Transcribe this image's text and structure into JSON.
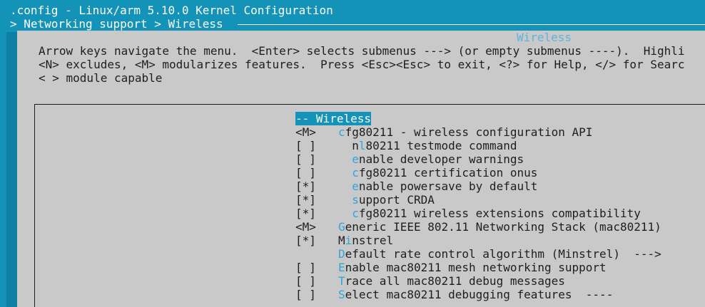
{
  "window": {
    "title": ".config - Linux/arm 5.10.0 Kernel Configuration",
    "breadcrumb": "> Networking support > Wireless"
  },
  "dialog": {
    "title": "Wireless",
    "help": [
      "Arrow keys navigate the menu.  <Enter> selects submenus ---> (or empty submenus ----).  Highli",
      "<N> excludes, <M> modularizes features.  Press <Esc><Esc> to exit, <?> for Help, </> for Searc",
      "< > module capable"
    ]
  },
  "menu": [
    {
      "state": "-",
      "pre": "-",
      "hot": "",
      "rest": " Wireless",
      "selected": true
    },
    {
      "state": "<M>",
      "pre": "",
      "hot": "c",
      "rest": "fg80211 - wireless configuration API"
    },
    {
      "state": "[ ]",
      "pre": "  n",
      "hot": "l",
      "rest": "80211 testmode command"
    },
    {
      "state": "[ ]",
      "pre": "  ",
      "hot": "e",
      "rest": "nable developer warnings"
    },
    {
      "state": "[ ]",
      "pre": "  ",
      "hot": "c",
      "rest": "fg80211 certification onus"
    },
    {
      "state": "[*]",
      "pre": "  ",
      "hot": "e",
      "rest": "nable powersave by default"
    },
    {
      "state": "[*]",
      "pre": "  ",
      "hot": "s",
      "rest": "upport CRDA"
    },
    {
      "state": "[*]",
      "pre": "  ",
      "hot": "c",
      "rest": "fg80211 wireless extensions compatibility"
    },
    {
      "state": "<M>",
      "pre": "",
      "hot": "G",
      "rest": "eneric IEEE 802.11 Networking Stack (mac80211)"
    },
    {
      "state": "[*]",
      "pre": "M",
      "hot": "i",
      "rest": "nstrel"
    },
    {
      "state": "",
      "pre": "",
      "hot": "D",
      "rest": "efault rate control algorithm (Minstrel)  --->"
    },
    {
      "state": "[ ]",
      "pre": "",
      "hot": "E",
      "rest": "nable mac80211 mesh networking support"
    },
    {
      "state": "[ ]",
      "pre": "",
      "hot": "T",
      "rest": "race all mac80211 debug messages"
    },
    {
      "state": "[ ]",
      "pre": "",
      "hot": "S",
      "rest": "elect mac80211 debugging features  ----"
    }
  ]
}
